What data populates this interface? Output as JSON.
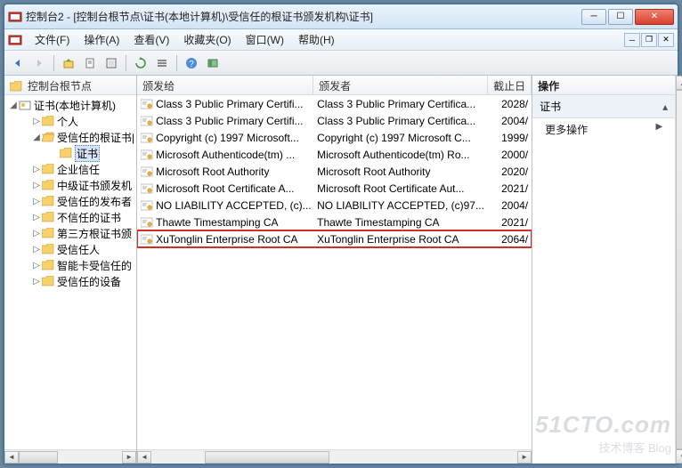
{
  "window": {
    "title": "控制台2 - [控制台根节点\\证书(本地计算机)\\受信任的根证书颁发机构\\证书]"
  },
  "menu": {
    "file": "文件(F)",
    "action": "操作(A)",
    "view": "查看(V)",
    "favorites": "收藏夹(O)",
    "window": "窗口(W)",
    "help": "帮助(H)"
  },
  "tree": {
    "header": "控制台根节点",
    "root": "证书(本地计算机)",
    "items": [
      "个人",
      "受信任的根证书|",
      "证书",
      "企业信任",
      "中级证书颁发机",
      "受信任的发布者",
      "不信任的证书",
      "第三方根证书颁",
      "受信任人",
      "智能卡受信任的",
      "受信任的设备"
    ]
  },
  "columns": {
    "c1": "颁发给",
    "c2": "颁发者",
    "c3": "截止日"
  },
  "rows": [
    {
      "to": "Class 3 Public Primary Certifi...",
      "by": "Class 3 Public Primary Certifica...",
      "exp": "2028/"
    },
    {
      "to": "Class 3 Public Primary Certifi...",
      "by": "Class 3 Public Primary Certifica...",
      "exp": "2004/"
    },
    {
      "to": "Copyright (c) 1997 Microsoft...",
      "by": "Copyright (c) 1997 Microsoft C...",
      "exp": "1999/"
    },
    {
      "to": "Microsoft Authenticode(tm) ...",
      "by": "Microsoft Authenticode(tm) Ro...",
      "exp": "2000/"
    },
    {
      "to": "Microsoft Root Authority",
      "by": "Microsoft Root Authority",
      "exp": "2020/"
    },
    {
      "to": "Microsoft Root Certificate A...",
      "by": "Microsoft Root Certificate Aut...",
      "exp": "2021/"
    },
    {
      "to": "NO LIABILITY ACCEPTED, (c)...",
      "by": "NO LIABILITY ACCEPTED, (c)97...",
      "exp": "2004/"
    },
    {
      "to": "Thawte Timestamping CA",
      "by": "Thawte Timestamping CA",
      "exp": "2021/"
    },
    {
      "to": "XuTonglin Enterprise Root CA",
      "by": "XuTonglin Enterprise Root CA",
      "exp": "2064/",
      "hl": true
    }
  ],
  "actions": {
    "header": "操作",
    "section": "证书",
    "more": "更多操作"
  },
  "watermark": {
    "big": "51CTO.com",
    "small": "技术博客  Blog"
  }
}
